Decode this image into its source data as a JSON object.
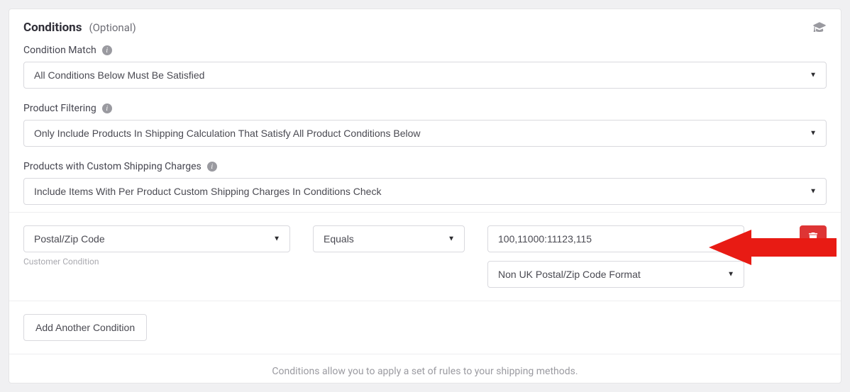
{
  "header": {
    "title": "Conditions",
    "hint": "(Optional)"
  },
  "fields": {
    "condition_match": {
      "label": "Condition Match",
      "selected": "All Conditions Below Must Be Satisfied"
    },
    "product_filtering": {
      "label": "Product Filtering",
      "selected": "Only Include Products In Shipping Calculation That Satisfy All Product Conditions Below"
    },
    "custom_shipping": {
      "label": "Products with Custom Shipping Charges",
      "selected": "Include Items With Per Product Custom Shipping Charges In Conditions Check"
    }
  },
  "condition_row": {
    "subject": "Postal/Zip Code",
    "subject_hint": "Customer Condition",
    "operator": "Equals",
    "value": "100,11000:11123,115",
    "format": "Non UK Postal/Zip Code Format"
  },
  "buttons": {
    "add_condition": "Add Another Condition"
  },
  "footer": {
    "note": "Conditions allow you to apply a set of rules to your shipping methods."
  }
}
